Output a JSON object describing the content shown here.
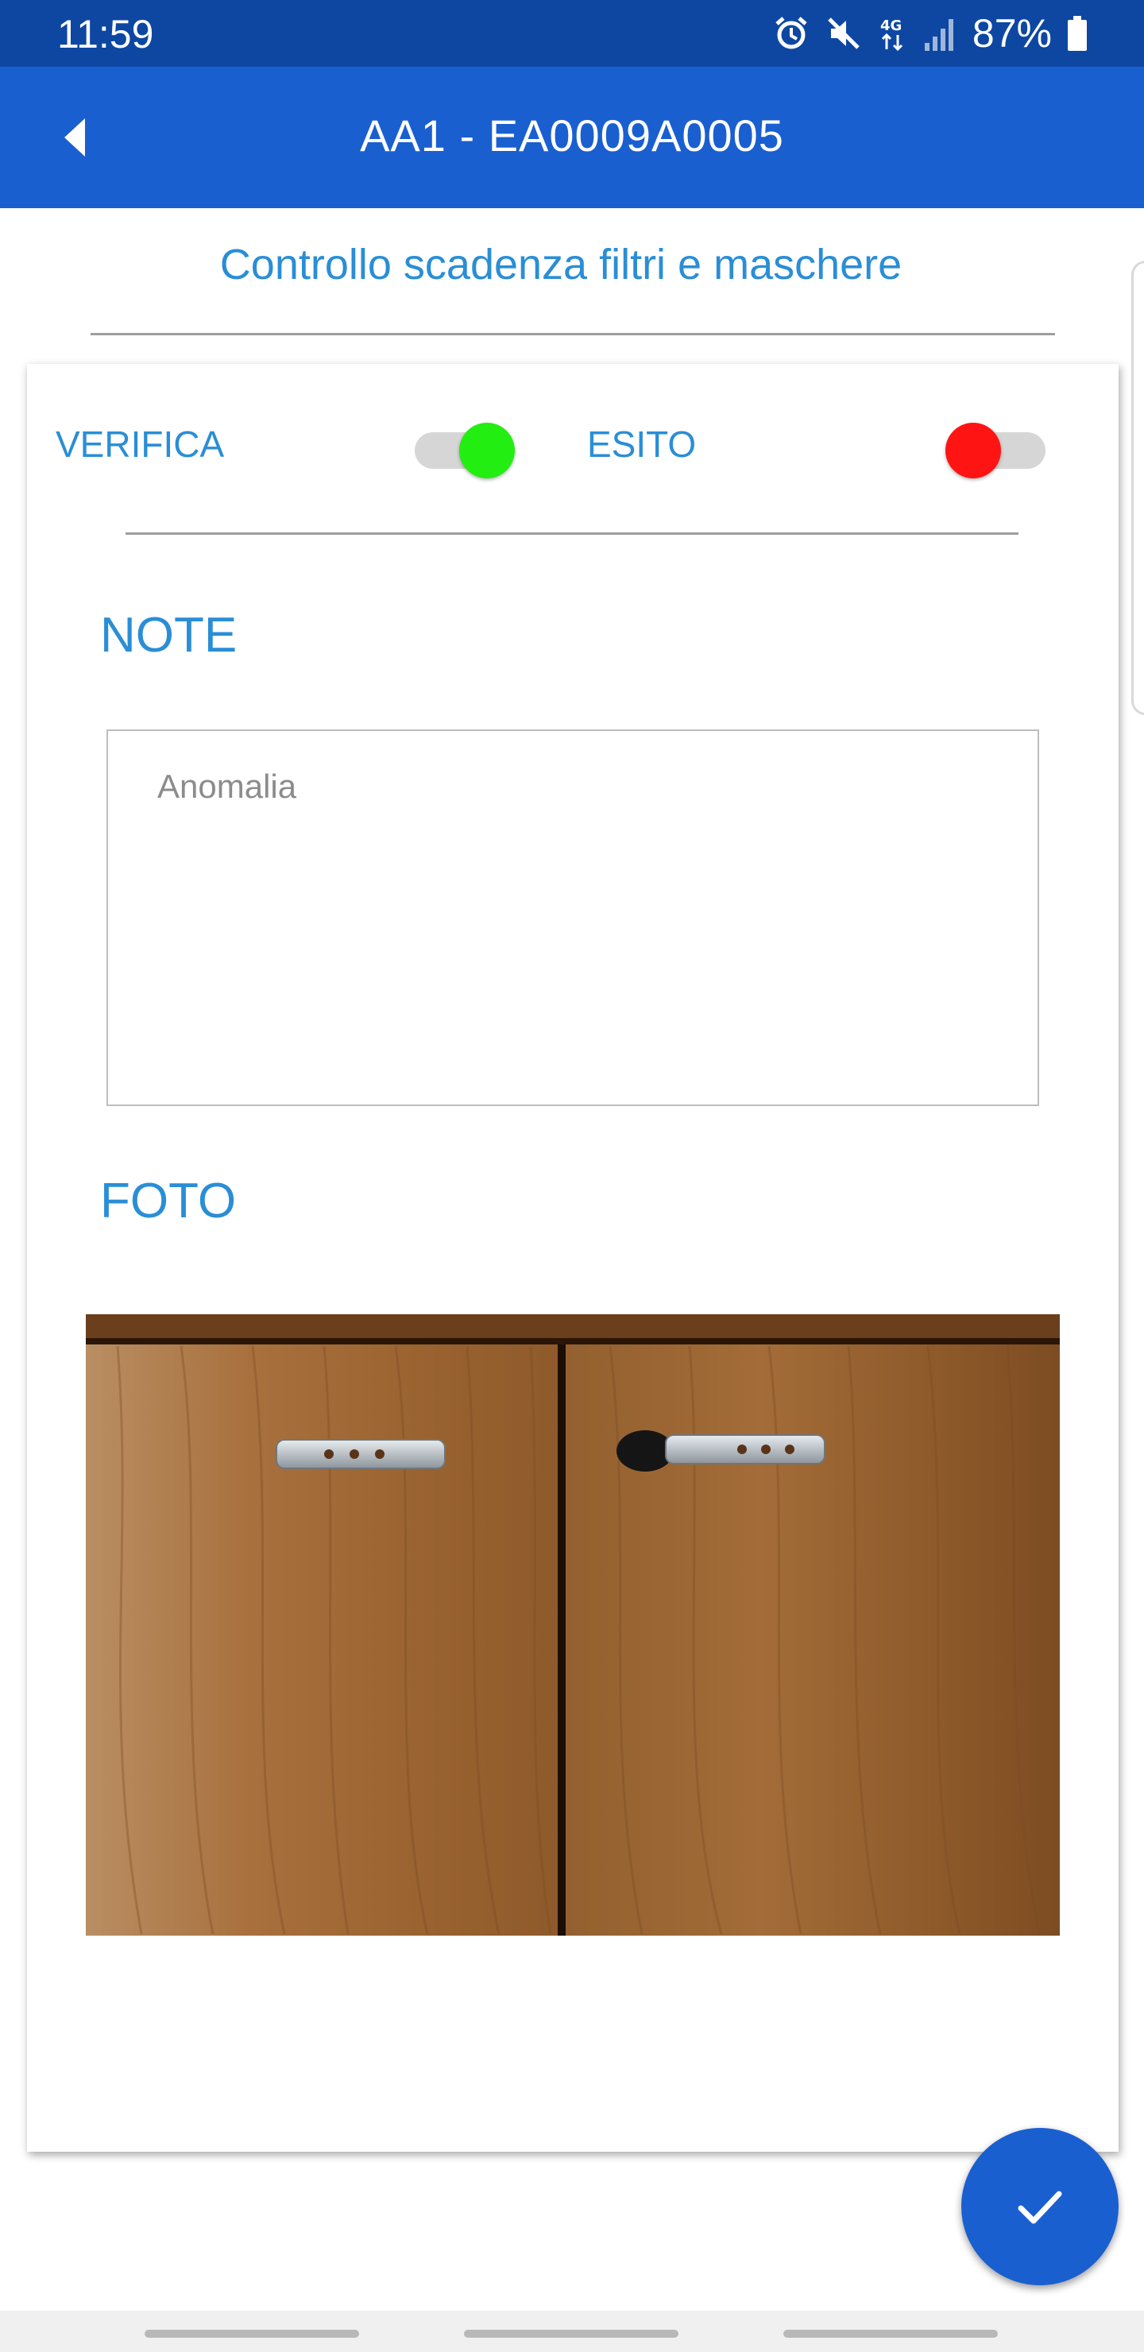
{
  "status_bar": {
    "time": "11:59",
    "network": "4G",
    "battery": "87%",
    "icons": [
      "alarm-icon",
      "mute-icon",
      "network-4g-icon",
      "signal-icon",
      "battery-icon"
    ]
  },
  "app_bar": {
    "title": "AA1 - EA0009A0005",
    "back_icon": "back-arrow-icon"
  },
  "section": {
    "title": "Controllo scadenza filtri e maschere"
  },
  "form": {
    "verifica": {
      "label": "VERIFICA",
      "on": true,
      "color": "#22ee11"
    },
    "esito": {
      "label": "ESITO",
      "on": false,
      "color": "#ff1414"
    },
    "note": {
      "label": "NOTE",
      "placeholder": "Anomalia",
      "value": ""
    },
    "foto": {
      "label": "FOTO",
      "image": "wooden-cabinet-doors-photo"
    }
  },
  "fab": {
    "icon": "check-icon"
  },
  "colors": {
    "status_bar": "#0d47a1",
    "app_bar": "#1a5fd0",
    "accent_text": "#2a8ed6"
  }
}
